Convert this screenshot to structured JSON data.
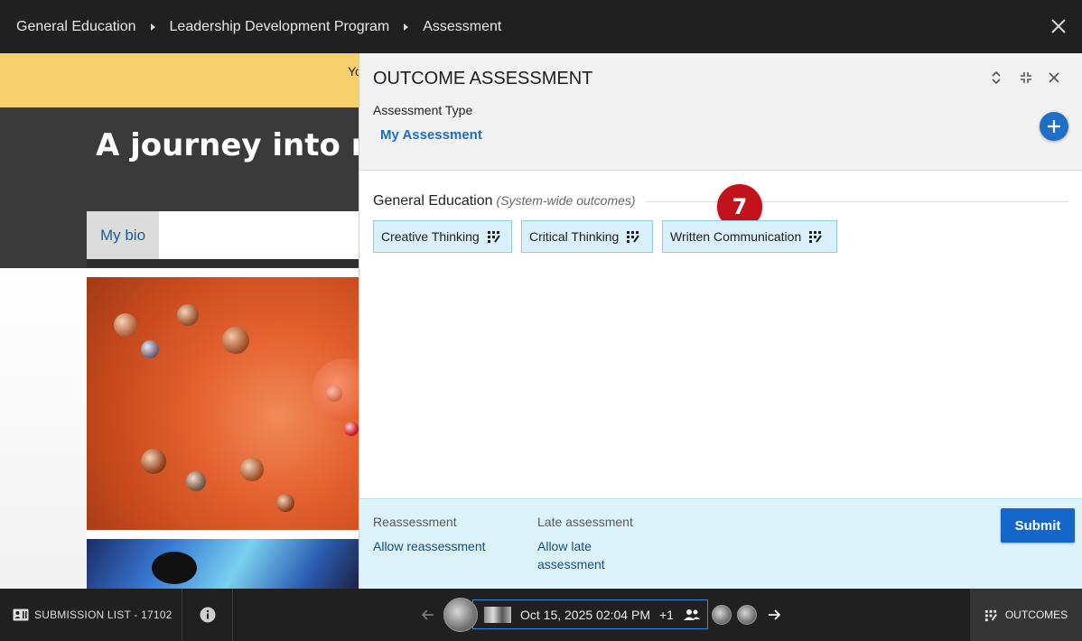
{
  "topbar": {
    "breadcrumbs": [
      "General Education",
      "Leadership Development Program",
      "Assessment"
    ],
    "close_icon": "close-icon"
  },
  "page": {
    "banner_text": "Yo",
    "hero_title": "A journey into m",
    "tab_label": "My bio"
  },
  "panel": {
    "title": "OUTCOME ASSESSMENT",
    "assessment_type_label": "Assessment Type",
    "assessment_type_value": "My Assessment",
    "section_title": "General Education",
    "section_subtitle": "(System-wide outcomes)",
    "badge_number": "7",
    "outcomes": [
      {
        "label": "Creative Thinking",
        "icon": "rubric-icon"
      },
      {
        "label": "Critical Thinking",
        "icon": "rubric-icon"
      },
      {
        "label": "Written Communication",
        "icon": "rubric-icon"
      }
    ],
    "footer": {
      "reassessment_label": "Reassessment",
      "reassessment_link": "Allow reassessment",
      "late_label": "Late assessment",
      "late_link": "Allow late assessment",
      "submit_label": "Submit"
    }
  },
  "bottombar": {
    "submission_list_label": "SUBMISSION LIST - 17102",
    "submission_date": "Oct 15, 2025 02:04 PM",
    "submission_count": "+1",
    "outcomes_label": "OUTCOMES"
  },
  "colors": {
    "accent": "#1467c8",
    "badge": "#c4121c",
    "chip_bg": "#d9f1fb",
    "banner": "#f6d06c"
  }
}
